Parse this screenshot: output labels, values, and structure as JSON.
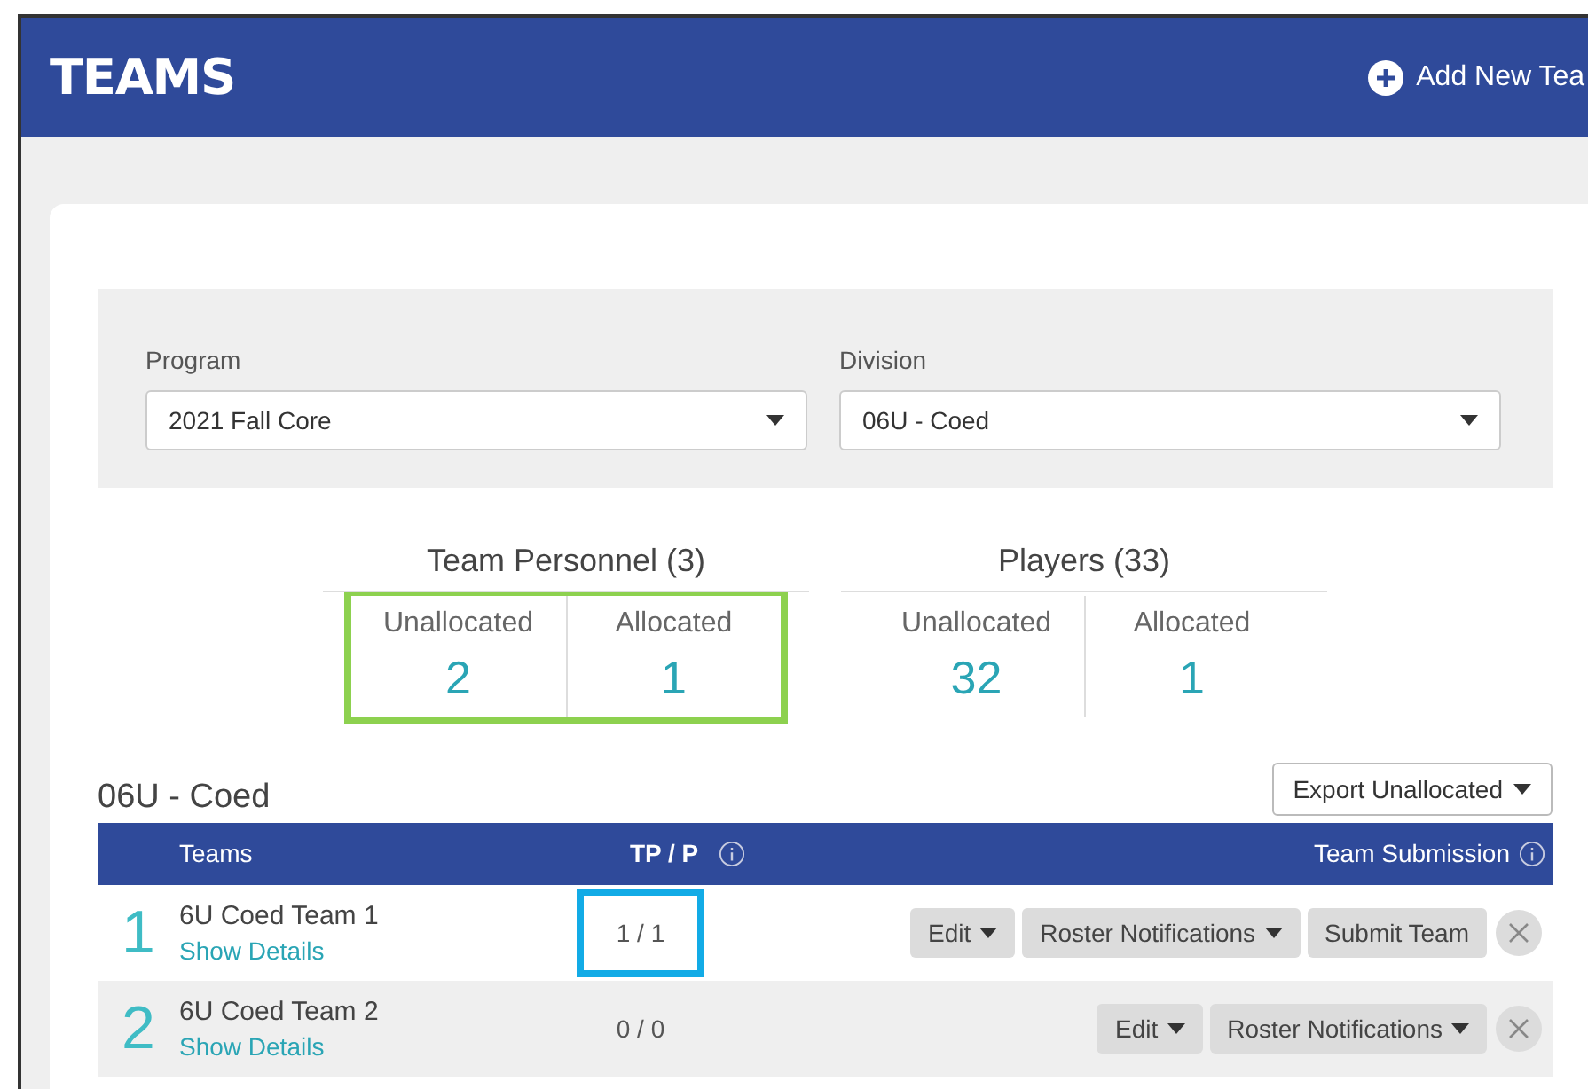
{
  "header": {
    "title": "TEAMS",
    "add_button": "Add New Tea"
  },
  "filters": [
    {
      "label": "Program",
      "value": "2021 Fall Core"
    },
    {
      "label": "Division",
      "value": "06U - Coed"
    }
  ],
  "stats": [
    {
      "title": "Team Personnel (3)",
      "highlighted": true,
      "items": [
        {
          "label": "Unallocated",
          "value": "2"
        },
        {
          "label": "Allocated",
          "value": "1"
        }
      ]
    },
    {
      "title": "Players (33)",
      "highlighted": false,
      "items": [
        {
          "label": "Unallocated",
          "value": "32"
        },
        {
          "label": "Allocated",
          "value": "1"
        }
      ]
    }
  ],
  "section_title": "06U - Coed",
  "export_button": "Export Unallocated",
  "table": {
    "columns": [
      "Teams",
      "TP / P",
      "Team Submission"
    ],
    "rows": [
      {
        "number": "1",
        "name": "6U Coed Team 1",
        "details_link": "Show Details",
        "tp_p": "1 / 1",
        "tp_p_highlighted": true,
        "actions": [
          "Edit",
          "Roster Notifications",
          "Submit Team"
        ]
      },
      {
        "number": "2",
        "name": "6U Coed Team 2",
        "details_link": "Show Details",
        "tp_p": "0 / 0",
        "tp_p_highlighted": false,
        "actions": [
          "Edit",
          "Roster Notifications"
        ]
      }
    ]
  }
}
